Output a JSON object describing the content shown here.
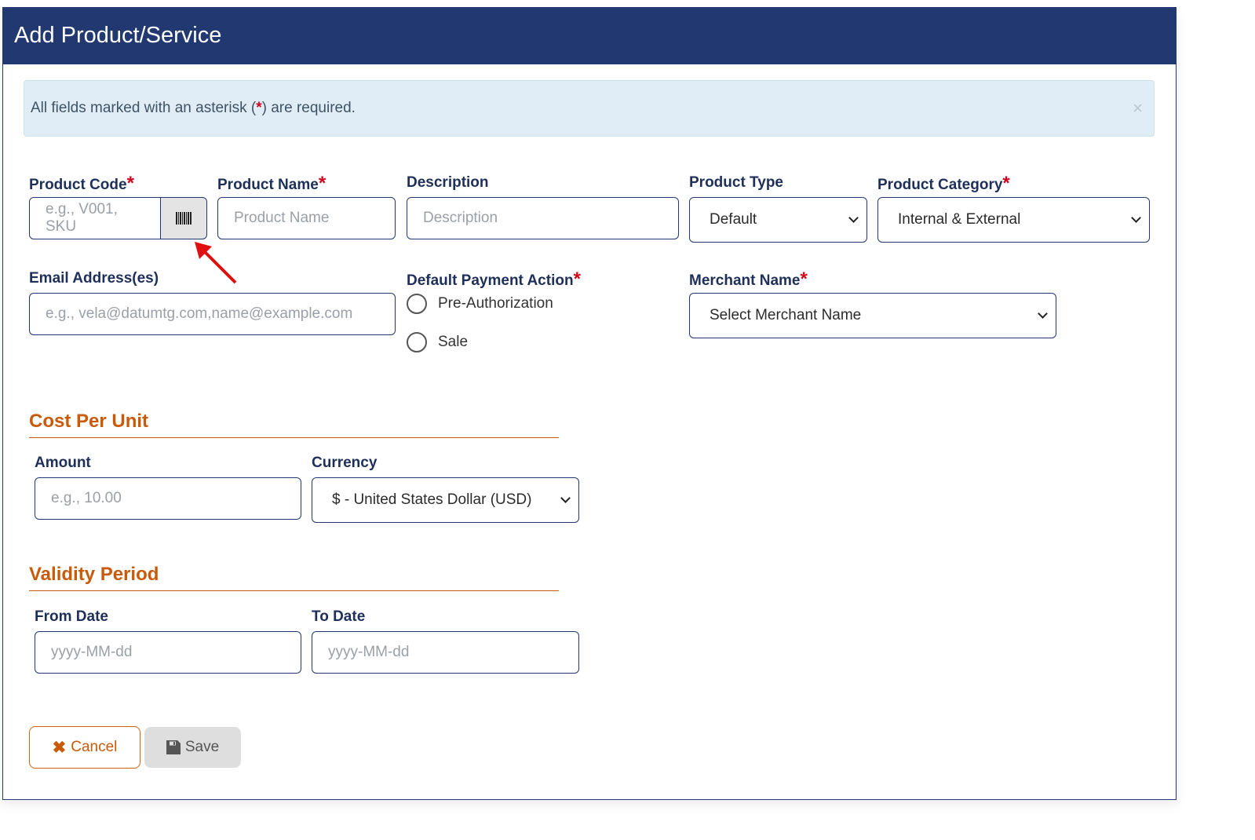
{
  "header": {
    "title": "Add Product/Service"
  },
  "alert": {
    "text_before": "All fields marked with an asterisk (",
    "asterisk": "*",
    "text_after": ") are required.",
    "close": "×"
  },
  "fields": {
    "product_code": {
      "label": "Product Code",
      "required": "*",
      "placeholder": "e.g., V001, SKU",
      "barcode_icon": "barcode-icon"
    },
    "product_name": {
      "label": "Product Name",
      "required": "*",
      "placeholder": "Product Name"
    },
    "description": {
      "label": "Description",
      "placeholder": "Description"
    },
    "product_type": {
      "label": "Product Type",
      "value": "Default"
    },
    "product_category": {
      "label": "Product Category",
      "required": "*",
      "value": "Internal & External"
    },
    "email": {
      "label": "Email Address(es)",
      "placeholder": "e.g., vela@datumtg.com,name@example.com"
    },
    "payment_action": {
      "label": "Default Payment Action",
      "required": "*",
      "options": [
        "Pre-Authorization",
        "Sale"
      ]
    },
    "merchant_name": {
      "label": "Merchant Name",
      "required": "*",
      "value": "Select Merchant Name"
    }
  },
  "cost": {
    "heading": "Cost Per Unit",
    "amount_label": "Amount",
    "amount_placeholder": "e.g., 10.00",
    "currency_label": "Currency",
    "currency_value": "$ - United States Dollar (USD)"
  },
  "validity": {
    "heading": "Validity Period",
    "from_label": "From Date",
    "from_placeholder": "yyyy-MM-dd",
    "to_label": "To Date",
    "to_placeholder": "yyyy-MM-dd"
  },
  "buttons": {
    "cancel": "Cancel",
    "save": "Save"
  },
  "colors": {
    "header": "#223870",
    "accent": "#c85a0a",
    "required": "#d0021b",
    "alert_bg": "#e1edf6"
  }
}
